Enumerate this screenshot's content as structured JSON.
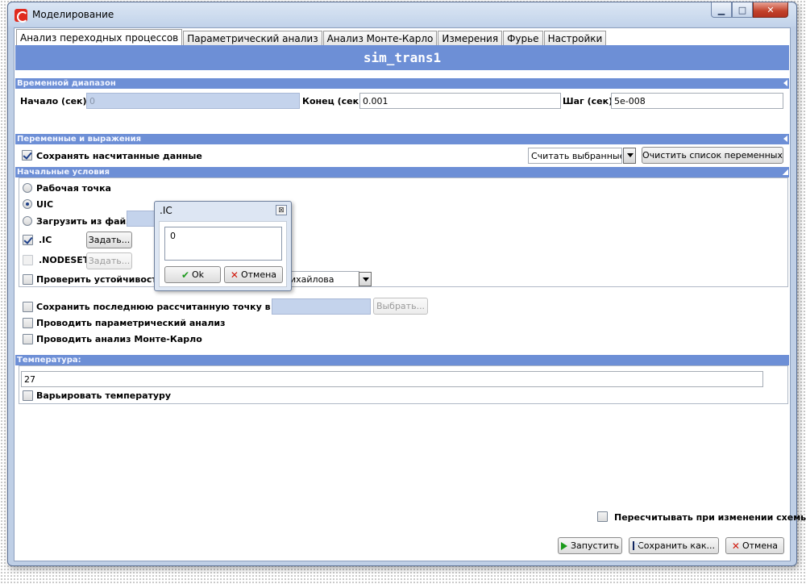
{
  "window": {
    "title": "Моделирование",
    "minimize": "▁",
    "maximize": "□",
    "close": "✕"
  },
  "tabs": [
    {
      "label": "Анализ переходных процессов",
      "active": true
    },
    {
      "label": "Параметрический анализ"
    },
    {
      "label": "Анализ Монте-Карло"
    },
    {
      "label": "Измерения"
    },
    {
      "label": "Фурье"
    },
    {
      "label": "Настройки"
    }
  ],
  "header": {
    "title": "sim_trans1"
  },
  "time_range": {
    "heading": "Временной диапазон",
    "start_label": "Начало (сек):",
    "start_value": "0",
    "end_label": "Конец (сек):",
    "end_value": "0.001",
    "step_label": "Шаг (сек):",
    "step_value": "5e-008"
  },
  "variables": {
    "heading": "Переменные и выражения",
    "save_data_label": "Сохранять насчитанные данные",
    "select_value": "Считать выбранные",
    "clear_button": "Очистить список переменных"
  },
  "initial_conditions": {
    "heading": "Начальные условия",
    "op_point": "Рабочая точка",
    "uic": "UIC",
    "load_file": "Загрузить из файла",
    "ic_label": ".IC",
    "ic_button": "Задать...",
    "nodeset_label": ".NODESET",
    "nodeset_button": "Задать...",
    "stability_label": "Проверить устойчивость в",
    "stability_method": "ихайлова"
  },
  "options": {
    "save_last_point": "Сохранить последнюю рассчитанную точку в файл",
    "choose_button": "Выбрать...",
    "param_analysis": "Проводить параметрический анализ",
    "monte_carlo": "Проводить анализ Монте-Карло"
  },
  "temperature": {
    "heading": "Температура:",
    "value": "27",
    "vary_label": "Варьировать температуру"
  },
  "footer": {
    "recalc_label": "Пересчитывать при изменении схемы",
    "run_button": "Запустить",
    "save_as_button": "Сохранить как...",
    "cancel_button": "Отмена"
  },
  "ic_dialog": {
    "title": ".IC",
    "close": "⊠",
    "value": "0",
    "ok_button": "Ok",
    "cancel_button": "Отмена"
  }
}
